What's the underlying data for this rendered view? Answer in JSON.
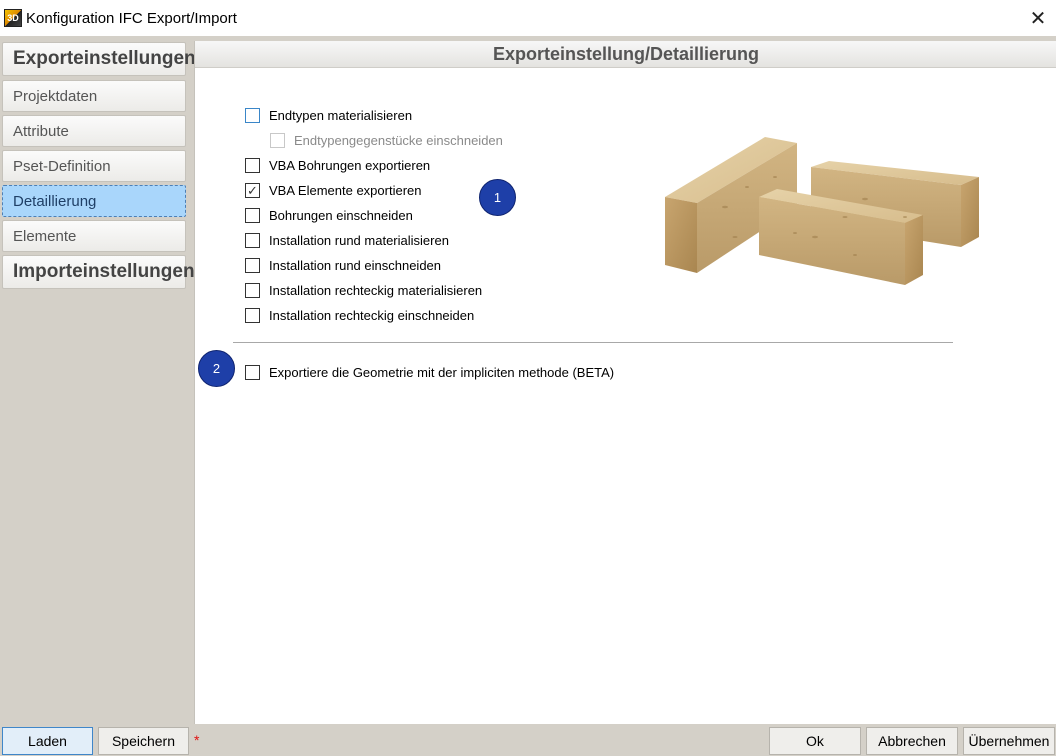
{
  "window": {
    "title": "Konfiguration IFC Export/Import",
    "close_symbol": "✕",
    "app_icon_text": "3D"
  },
  "sidebar": {
    "export_header": "Exporteinstellungen",
    "items": [
      {
        "label": "Projektdaten"
      },
      {
        "label": "Attribute"
      },
      {
        "label": "Pset-Definition"
      },
      {
        "label": "Detaillierung",
        "active": true
      },
      {
        "label": "Elemente"
      }
    ],
    "import_header": "Importeinstellungen"
  },
  "panel": {
    "title": "Exporteinstellung/Detaillierung",
    "options": [
      {
        "label": "Endtypen materialisieren",
        "checked": false
      },
      {
        "label": "Endtypengegenstücke einschneiden",
        "checked": false,
        "disabled": true
      },
      {
        "label": "VBA Bohrungen exportieren",
        "checked": false
      },
      {
        "label": "VBA Elemente exportieren",
        "checked": true
      },
      {
        "label": "Bohrungen einschneiden",
        "checked": false
      },
      {
        "label": "Installation rund materialisieren",
        "checked": false
      },
      {
        "label": "Installation rund einschneiden",
        "checked": false
      },
      {
        "label": "Installation rechteckig materialisieren",
        "checked": false
      },
      {
        "label": "Installation rechteckig einschneiden",
        "checked": false
      }
    ],
    "beta_option": {
      "label": "Exportiere die Geometrie mit der impliciten methode (BETA)",
      "checked": false
    },
    "badges": [
      "1",
      "2"
    ],
    "check_glyph": "✓"
  },
  "footer": {
    "laden": "Laden",
    "speichern": "Speichern",
    "unsaved_marker": "*",
    "ok": "Ok",
    "abbrechen": "Abbrechen",
    "uebernehmen": "Übernehmen"
  },
  "colors": {
    "accent": "#a9d6fb",
    "badge": "#1e3fa8",
    "wood": "#c9a978"
  }
}
